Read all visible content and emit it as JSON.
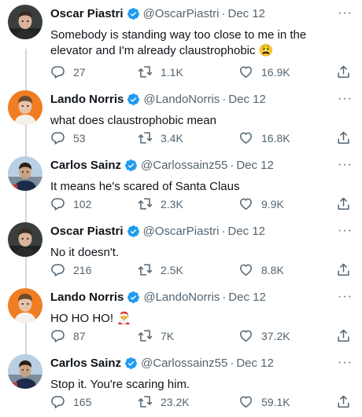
{
  "tweets": [
    {
      "name": "Oscar Piastri",
      "handle": "@OscarPiastri",
      "date": "Dec 12",
      "text": "Somebody is standing way too close to me in the elevator and I'm already claustrophobic 😩",
      "replies": "27",
      "retweets": "1.1K",
      "likes": "16.9K"
    },
    {
      "name": "Lando Norris",
      "handle": "@LandoNorris",
      "date": "Dec 12",
      "text": "what does claustrophobic mean",
      "replies": "53",
      "retweets": "3.4K",
      "likes": "16.8K"
    },
    {
      "name": "Carlos Sainz",
      "handle": "@Carlossainz55",
      "date": "Dec 12",
      "text": "It means he's scared of Santa Claus",
      "replies": "102",
      "retweets": "2.3K",
      "likes": "9.9K"
    },
    {
      "name": "Oscar Piastri",
      "handle": "@OscarPiastri",
      "date": "Dec 12",
      "text": "No it doesn't.",
      "replies": "216",
      "retweets": "2.5K",
      "likes": "8.8K"
    },
    {
      "name": "Lando Norris",
      "handle": "@LandoNorris",
      "date": "Dec 12",
      "text": "HO HO HO! 🎅",
      "replies": "87",
      "retweets": "7K",
      "likes": "37.2K"
    },
    {
      "name": "Carlos Sainz",
      "handle": "@Carlossainz55",
      "date": "Dec 12",
      "text": "Stop it. You're scaring him.",
      "replies": "165",
      "retweets": "23.2K",
      "likes": "59.1K"
    }
  ],
  "separator": "·",
  "more_glyph": "···",
  "colors": {
    "verified": "#1d9bf0",
    "text": "#0f1419",
    "secondary": "#536471",
    "thread_line": "#cfd9de"
  },
  "icons": {
    "reply": "reply-icon",
    "retweet": "retweet-icon",
    "like": "like-icon",
    "share": "share-icon",
    "verified": "verified-badge-icon",
    "more": "more-options-icon"
  }
}
